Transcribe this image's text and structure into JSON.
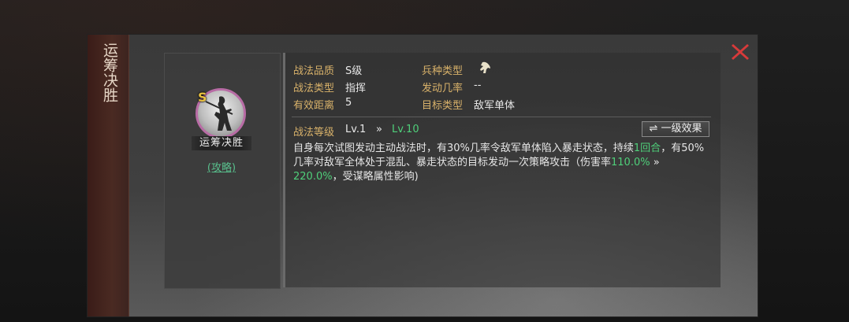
{
  "skill": {
    "side_title": "运筹决胜",
    "plate_name": "运筹决胜",
    "grade_badge": "S",
    "guide_link": "(攻略)"
  },
  "info": {
    "quality_label": "战法品质",
    "quality_value": "S级",
    "type_label": "战法类型",
    "type_value": "指挥",
    "range_label": "有效距离",
    "range_value": "5",
    "unit_label": "兵种类型",
    "unit_icon": "cavalry-horse-icon",
    "chance_label": "发动几率",
    "chance_value": "--",
    "target_label": "目标类型",
    "target_value": "敌军单体"
  },
  "level": {
    "label": "战法等级",
    "current": "Lv.1",
    "arrow": "»",
    "max": "Lv.10",
    "effect_button": "⇌ 一级效果"
  },
  "description": {
    "part1": "自身每次试图发动主动战法时，有30%几率令敌军单体陷入暴走状态，持续",
    "turns": "1回合",
    "part2": "，有50%几率对敌军全体处于混乱、暴走状态的目标发动一次策略攻击（伤害率",
    "rate_lv1": "110.0%",
    "arrow": " » ",
    "rate_lv10": "220.0%",
    "part3": "，受谋略属性影响)"
  },
  "colors": {
    "label_gold": "#d9b26a",
    "value_green": "#4fcf7a",
    "close_red": "#d83a3a",
    "portrait_ring": "#b86ca5"
  }
}
